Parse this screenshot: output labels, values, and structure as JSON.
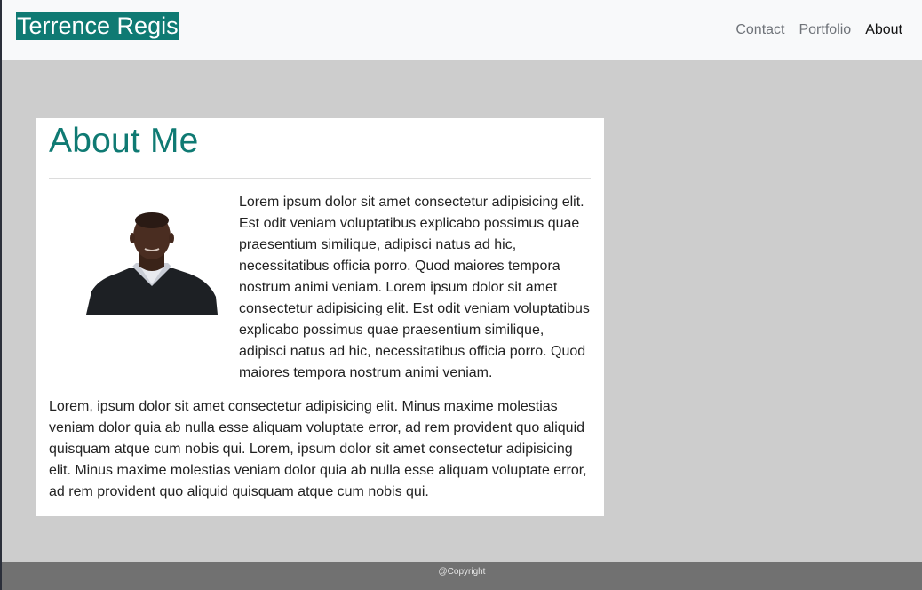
{
  "navbar": {
    "brand": "Terrence Regis",
    "links": [
      "Contact",
      "Portfolio",
      "About"
    ],
    "active": "About"
  },
  "about": {
    "title": "About Me",
    "intro": "Lorem ipsum dolor sit amet consectetur adipisicing elit. Est odit veniam voluptatibus explicabo possimus quae praesentium similique, adipisci natus ad hic, necessitatibus officia porro. Quod maiores tempora nostrum animi veniam. Lorem ipsum dolor sit amet consectetur adipisicing elit. Est odit veniam voluptatibus explicabo possimus quae praesentium similique, adipisci natus ad hic, necessitatibus officia porro. Quod maiores tempora nostrum animi veniam.",
    "bio": "Lorem, ipsum dolor sit amet consectetur adipisicing elit. Minus maxime molestias veniam dolor quia ab nulla esse aliquam voluptate error, ad rem provident quo aliquid quisquam atque cum nobis qui. Lorem, ipsum dolor sit amet consectetur adipisicing elit. Minus maxime molestias veniam dolor quia ab nulla esse aliquam voluptate error, ad rem provident quo aliquid quisquam atque cum nobis qui."
  },
  "footer": {
    "text": "@Copyright"
  },
  "colors": {
    "accent": "#0f7a73",
    "page_background": "#cdcdcd",
    "navbar_background": "#f8f9fa",
    "footer_background": "#717171"
  }
}
